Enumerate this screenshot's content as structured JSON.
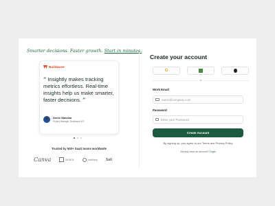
{
  "headline": {
    "part1": "Smarter decisions. Faster growth. ",
    "link": "Start in minutes."
  },
  "testimonial": {
    "brand": "Buildwave",
    "open_quote": "“",
    "text": "Insightly makes tracking metrics effortless. Real-time insights help us make smarter, faster decisions.",
    "close_quote": "”",
    "author_name": "Denis Stavska",
    "author_role": "Project Manager, Buildwave INT."
  },
  "carousel": {
    "count": 3,
    "active_index": 0
  },
  "trusted": {
    "text": "Trusted by 500+ SaaS teams worldwide",
    "logos": [
      "Canva",
      "BIGBOX",
      "mailchimp",
      "Salt"
    ]
  },
  "form": {
    "title": "Create your account",
    "social_icons": [
      "google-icon",
      "microsoft-icon",
      "apple-icon"
    ],
    "or_text": "or",
    "email_label": "Work Email",
    "email_placeholder": "name@company.com",
    "password_label": "Password",
    "password_placeholder": "Enter your Password",
    "submit_label": "Create Account",
    "terms_text": "By signing up, you agree to our Terms and Privacy Policy",
    "signin_prefix": "Already have an account?",
    "signin_link": "Login"
  },
  "colors": {
    "accent": "#1d5a3f",
    "brand": "#e04b22",
    "background": "#eeeeee"
  }
}
